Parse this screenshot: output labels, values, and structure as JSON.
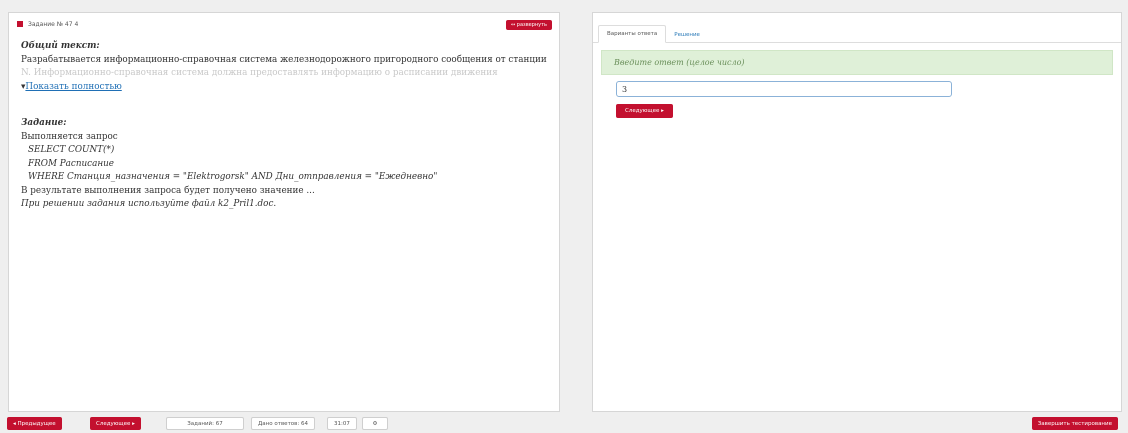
{
  "task": {
    "header": "Задание № 47 4",
    "expand_label": "↔ развернуть",
    "general_heading": "Общий текст:",
    "general_line1": "Разрабатывается информационно-справочная система железнодорожного пригородного сообщения от станции",
    "general_line2": "N. Информационно-справочная система должна предоставлять информацию о расписании движения",
    "show_all": "Показать полностью",
    "task_heading": "Задание:",
    "query_intro": "Выполняется запрос",
    "code_lines": [
      "SELECT COUNT(*)",
      "FROM Расписание",
      "WHERE Станция_назначения = \"Elektrogorsk\" AND Дни_отправления = \"Ежедневно\""
    ],
    "result_text": "В результате выполнения запроса будет получено значение ...",
    "hint": "При решении задания используйте файл k2_Pril1.doc."
  },
  "answer_panel": {
    "tabs": [
      "Варианты ответа",
      "Решение"
    ],
    "prompt": "Введите ответ (целое число)",
    "answer_value": "3",
    "next_label": "Следующее ▸"
  },
  "footer": {
    "prev": "◂ Предыдущее",
    "next": "Следующее ▸",
    "tasks": "Заданий: 67",
    "answers": "Дано ответов: 64",
    "time": "31:07",
    "finish": "Завершить тестирование"
  },
  "colors": {
    "accent": "#c3102f",
    "success_bg": "#dff0d8",
    "link": "#1f6fb5"
  }
}
